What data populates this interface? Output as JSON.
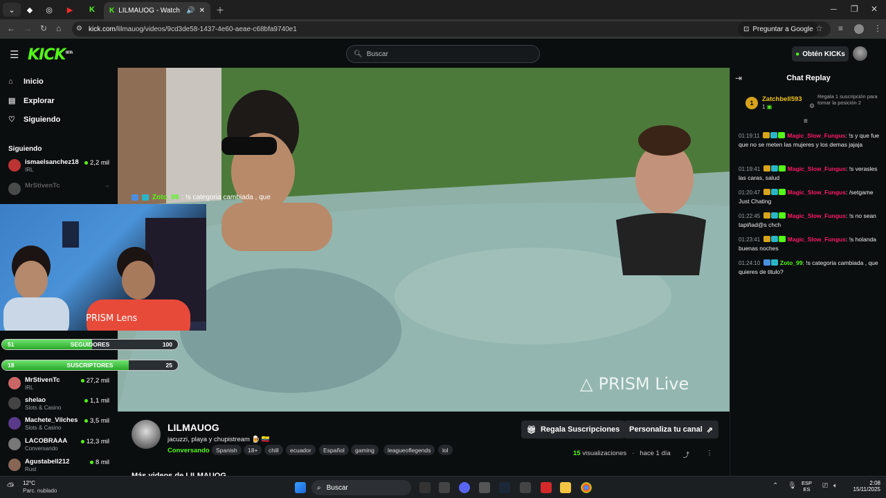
{
  "browser": {
    "active_tab_title": "LILMAUOG - Watch the VO",
    "url_domain": "kick.com",
    "url_path": "/lilmauog/videos/9cd3de58-1437-4e60-aeae-c68bfa9740e1",
    "google_button": "Preguntar a Google"
  },
  "header": {
    "logo": "KICK",
    "logo_sup": "BETA",
    "search_placeholder": "Buscar",
    "kicks_button": "Obtén KICKs"
  },
  "sidebar": {
    "nav": [
      {
        "label": "Inicio",
        "icon": "home-icon"
      },
      {
        "label": "Explorar",
        "icon": "explore-icon"
      },
      {
        "label": "Siguiendo",
        "icon": "heart-icon"
      }
    ],
    "following_title": "Siguiendo",
    "following": [
      {
        "name": "ismaelsanchez18",
        "category": "IRL",
        "viewers": "2,2 mil",
        "color": "#b33"
      },
      {
        "name": "MrStivenTc",
        "category": "",
        "viewers": "",
        "color": "#888"
      },
      {
        "name": "MrStivenTc",
        "category": "IRL",
        "viewers": "27,2 mil",
        "color": "#c66"
      },
      {
        "name": "shelao",
        "category": "Slots & Casino",
        "viewers": "1,1 mil",
        "color": "#444"
      },
      {
        "name": "Machete_Vilches",
        "category": "Slots & Casino",
        "viewers": "3,5 mil",
        "color": "#5a3a8a"
      },
      {
        "name": "LACOBRAAA",
        "category": "Conversando",
        "viewers": "12,3 mil",
        "color": "#777"
      },
      {
        "name": "Agustabell212",
        "category": "Rust",
        "viewers": "8 mil",
        "color": "#865"
      }
    ]
  },
  "overlay": {
    "prism_lens": "PRISM Lens",
    "followers_bar": {
      "low": "51",
      "label": "SEGUIDORES",
      "high": "100",
      "progress": 0.51
    },
    "subs_bar": {
      "low": "18",
      "label": "SUSCRIPTORES",
      "high": "25",
      "progress": 0.72
    },
    "video_chat_user": "Zoto_99",
    "video_chat_text": ": !s categoria cambiada , que",
    "prism_live": "PRISM Live"
  },
  "channel": {
    "name": "LILMAUOG",
    "title": "jacuzzi, playa y chupistream 🍺 🇪🇨",
    "category": "Conversando",
    "tags": [
      "Spanish",
      "18+",
      "chill",
      "ecuador",
      "Español",
      "gaming",
      "leagueoflegends",
      "lol"
    ],
    "gift_button": "Regala Suscripciones",
    "customize_button": "Personaliza tu canal",
    "views_count": "15",
    "views_label": "visualizaciones",
    "time_ago": "hace 1 día",
    "more_videos": "Más videos de LILMAUOG"
  },
  "chat": {
    "title": "Chat Replay",
    "pinned": {
      "rank": "1",
      "user": "Zatchbell593",
      "count": "1",
      "note": "Regala 1 suscripción para tomar la posición 2"
    },
    "messages": [
      {
        "time": "01:19:11",
        "user": "Magic_Slow_Fungus",
        "text": ": !s y que fue que no se meten las mujeres y los demas jajaja",
        "color": "#ff1a66"
      },
      {
        "time": "01:19:41",
        "user": "Magic_Slow_Fungus",
        "text": ": !s verasles las caras, salud",
        "color": "#ff1a66"
      },
      {
        "time": "01:20:47",
        "user": "Magic_Slow_Fungus",
        "text": ": /setgame Just Chating",
        "color": "#ff1a66"
      },
      {
        "time": "01:22:45",
        "user": "Magic_Slow_Fungus",
        "text": ": !s no sean tapiñad@s chch",
        "color": "#ff1a66"
      },
      {
        "time": "01:23:41",
        "user": "Magic_Slow_Fungus",
        "text": ": !s holanda buenas noches",
        "color": "#ff1a66"
      },
      {
        "time": "01:24:10",
        "user": "Zoto_99",
        "text": ": !s categoria cambiada , que quieres de titulo?",
        "color": "#53fc18"
      }
    ]
  },
  "taskbar": {
    "weather_temp": "12°C",
    "weather_desc": "Parc. nublado",
    "search": "Buscar",
    "lang_top": "ESP",
    "lang_bottom": "ES",
    "time": "2:08",
    "date": "15/11/2025"
  },
  "colors": {
    "accent": "#53fc18",
    "bg": "#0b0e0f"
  }
}
